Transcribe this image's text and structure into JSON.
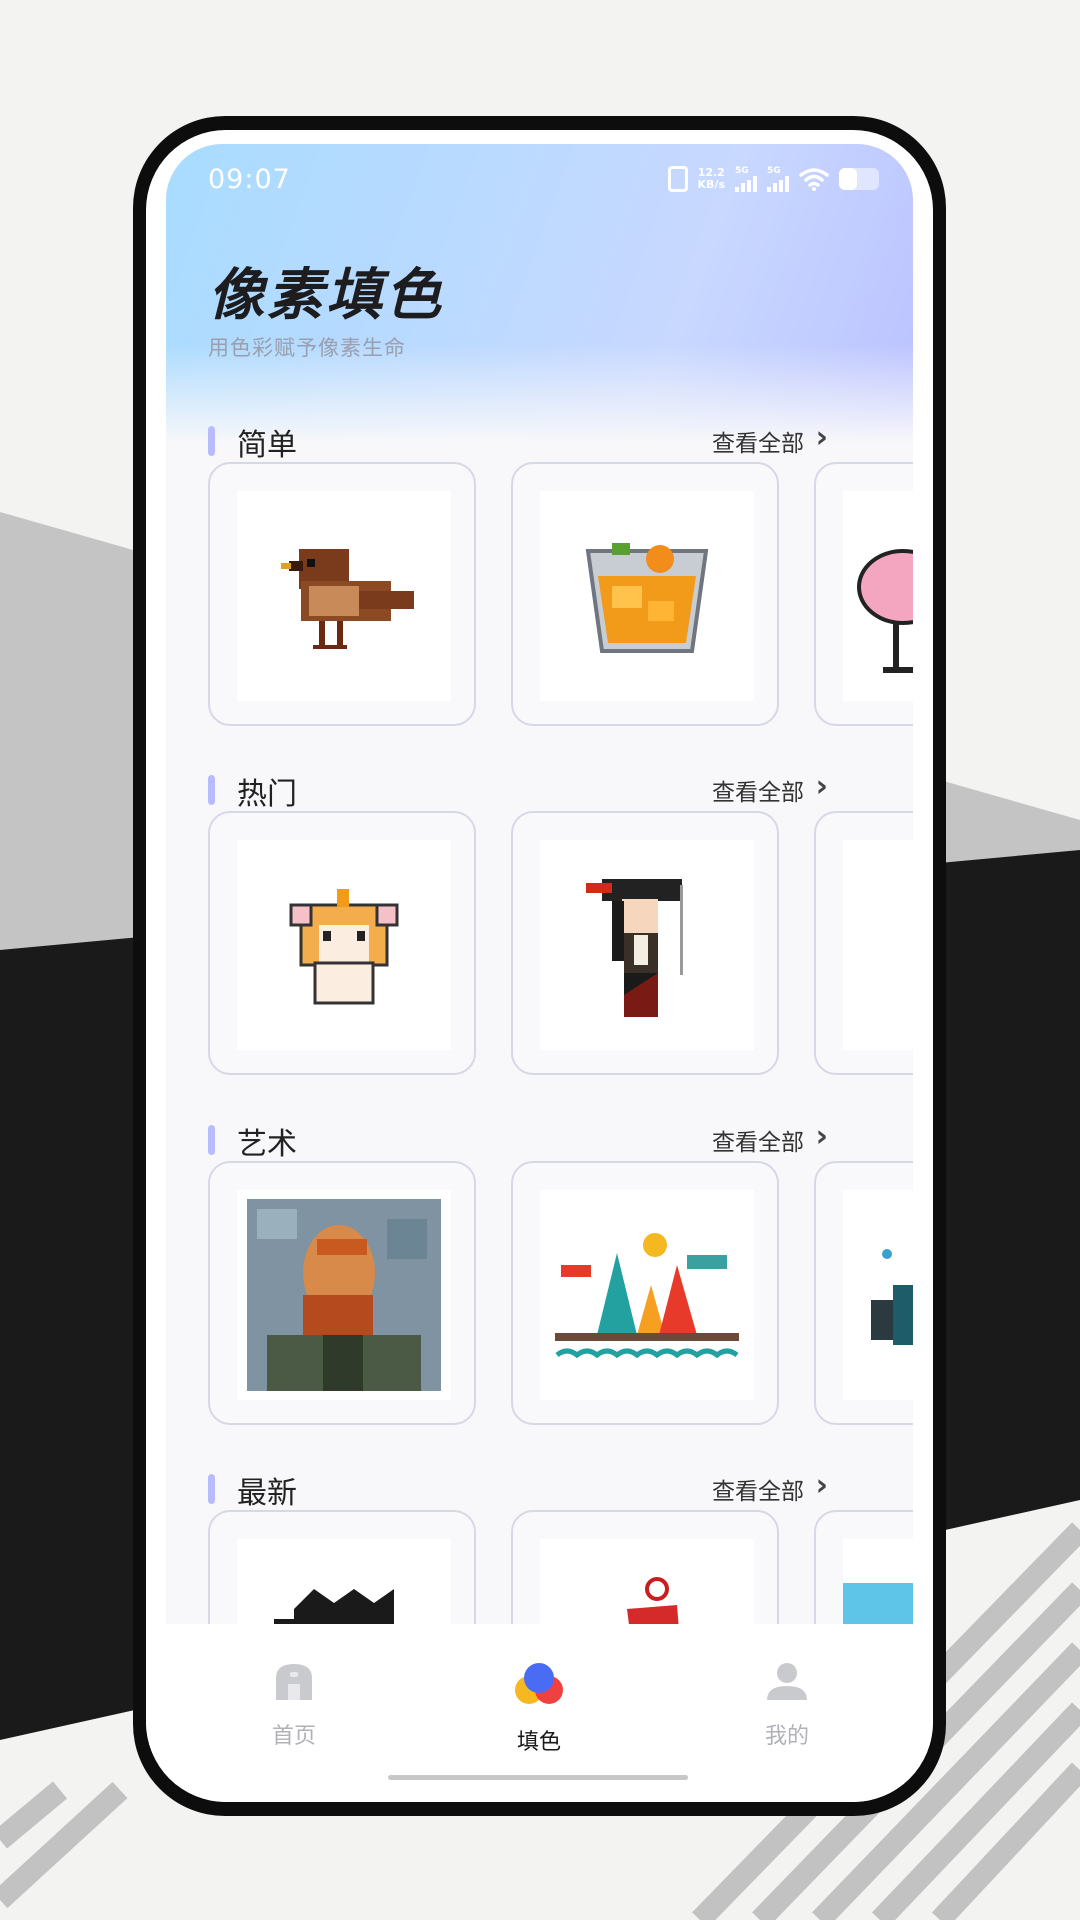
{
  "status_bar": {
    "time": "09:07",
    "speed_value": "12.2",
    "speed_unit": "KB/s",
    "signal_1": "5G",
    "signal_2": "5G"
  },
  "header": {
    "title": "像素填色",
    "subtitle": "用色彩赋予像素生命"
  },
  "sections": [
    {
      "name": "简单",
      "more": "查看全部"
    },
    {
      "name": "热门",
      "more": "查看全部"
    },
    {
      "name": "艺术",
      "more": "查看全部"
    },
    {
      "name": "最新",
      "more": "查看全部"
    }
  ],
  "tab_bar": {
    "items": [
      {
        "label": "首页",
        "icon": "home-icon",
        "active": false
      },
      {
        "label": "填色",
        "icon": "color-fill-icon",
        "active": true
      },
      {
        "label": "我的",
        "icon": "profile-icon",
        "active": false
      }
    ]
  },
  "colors": {
    "accent": "#b8bcff",
    "card_border": "#d6d8e6",
    "active_blue": "#4a6cf5"
  }
}
